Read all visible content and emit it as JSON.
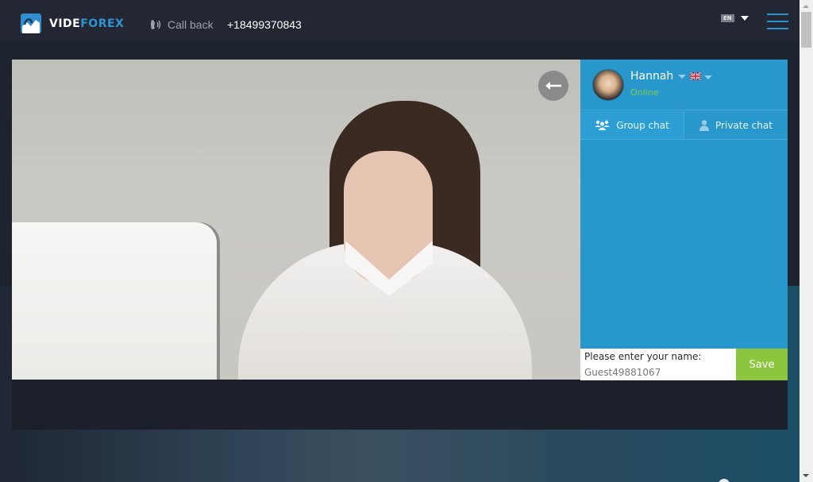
{
  "header": {
    "logo": {
      "part1": "VIDE",
      "part2": "FOREX",
      "icon": "videforex-logo-icon"
    },
    "callback": {
      "label": "Call back",
      "icon": "phone-icon"
    },
    "phone": "+18499370843",
    "language": {
      "code": "EN",
      "icon": "chevron-down-icon"
    },
    "menu_icon": "hamburger-menu-icon"
  },
  "video": {
    "back_button_icon": "arrow-left-icon"
  },
  "chat": {
    "host": {
      "name": "Hannah",
      "status": "Online",
      "language_flag": "uk-flag-icon"
    },
    "tabs": [
      {
        "label": "Group chat",
        "icon": "group-icon",
        "active": true
      },
      {
        "label": "Private chat",
        "icon": "user-icon",
        "active": false
      }
    ],
    "name_form": {
      "label": "Please enter your name:",
      "value": "Guest49881067",
      "save_label": "Save"
    }
  },
  "colors": {
    "header_bg": "#222733",
    "brand_blue": "#2f92d2",
    "chat_bg": "#2897cc",
    "online_green": "#7bd04a",
    "save_green": "#8cc63f"
  }
}
